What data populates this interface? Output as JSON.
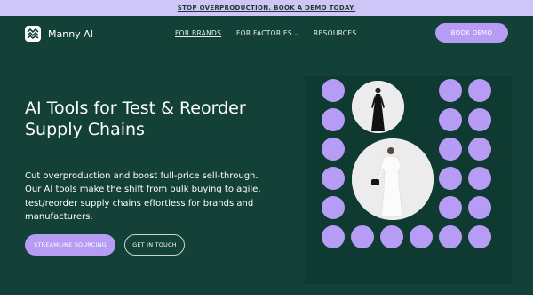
{
  "announcement": {
    "text": "STOP OVERPRODUCTION. BOOK A DEMO TODAY."
  },
  "brand": {
    "name": "Manny AI",
    "icon": "manny-logo-icon"
  },
  "nav": {
    "items": [
      {
        "label": "FOR BRANDS",
        "active": true
      },
      {
        "label": "FOR FACTORIES",
        "dropdown": true
      },
      {
        "label": "RESOURCES"
      }
    ]
  },
  "cta": {
    "book_demo": "BOOK DEMO"
  },
  "hero": {
    "title_line1": "AI Tools for Test & Reorder",
    "title_line2": "Supply Chains",
    "subtitle_line1": "Cut overproduction and boost full-price sell-through.",
    "subtitle_line2": "Our AI tools make the shift from bulk buying to agile,",
    "subtitle_line3": "test/reorder supply chains effortless for brands and",
    "subtitle_line4": "manufacturers.",
    "primary_button": "STREAMLINE SOURCING",
    "secondary_button": "GET IN TOUCH"
  },
  "colors": {
    "hero_bg": "#134137",
    "accent": "#b69cf5",
    "announcement_bg": "#cfc6f7"
  }
}
